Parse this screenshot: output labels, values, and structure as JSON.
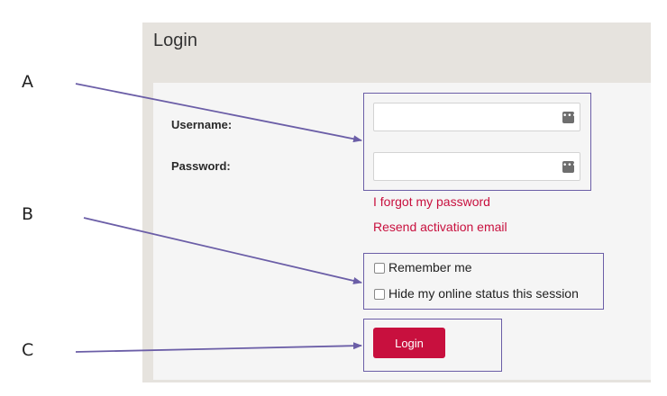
{
  "panel": {
    "title": "Login"
  },
  "form": {
    "username_label": "Username:",
    "password_label": "Password:",
    "username_value": "",
    "password_value": "",
    "forgot_password_link": "I forgot my password",
    "resend_activation_link": "Resend activation email",
    "remember_me_label": "Remember me",
    "hide_status_label": "Hide my online status this session",
    "login_button": "Login"
  },
  "callouts": {
    "a": "A",
    "b": "B",
    "c": "C"
  },
  "colors": {
    "accent": "#c8103e",
    "annotation": "#6b5ea7",
    "panel_bg": "#e6e3de"
  }
}
